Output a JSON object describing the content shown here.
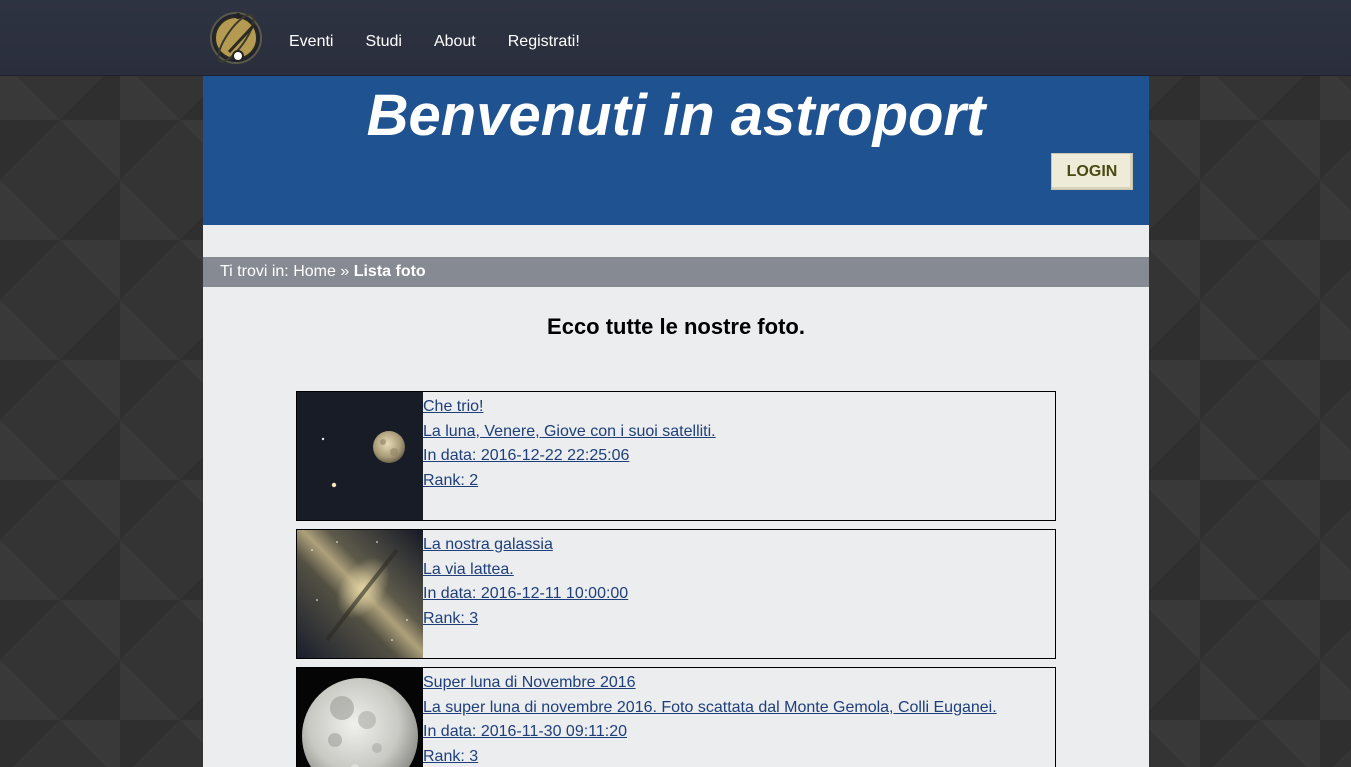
{
  "nav": {
    "items": [
      {
        "label": "Eventi"
      },
      {
        "label": "Studi"
      },
      {
        "label": "About"
      },
      {
        "label": "Registrati!"
      }
    ]
  },
  "header": {
    "title": "Benvenuti in astroport",
    "login_label": "LOGIN"
  },
  "breadcrumb": {
    "prefix": "Ti trovi in:",
    "home": "Home",
    "separator": "»",
    "current": "Lista foto"
  },
  "main": {
    "heading": "Ecco tutte le nostre foto."
  },
  "photos": [
    {
      "title": "Che trio!",
      "description": "La luna, Venere, Giove con i suoi satelliti.",
      "date": "In data: 2016-12-22 22:25:06",
      "rank": "Rank: 2"
    },
    {
      "title": "La nostra galassia",
      "description": "La via lattea.",
      "date": "In data: 2016-12-11 10:00:00",
      "rank": "Rank: 3"
    },
    {
      "title": "Super luna di Novembre 2016",
      "description": "La super luna di novembre 2016. Foto scattata dal Monte Gemola, Colli Euganei.",
      "date": "In data: 2016-11-30 09:11:20",
      "rank": "Rank: 3"
    }
  ],
  "colors": {
    "header_blue": "#1f5291",
    "link": "#1e3f7a",
    "breadcrumb_bg": "#868a92",
    "topbar": "#2c303e"
  }
}
